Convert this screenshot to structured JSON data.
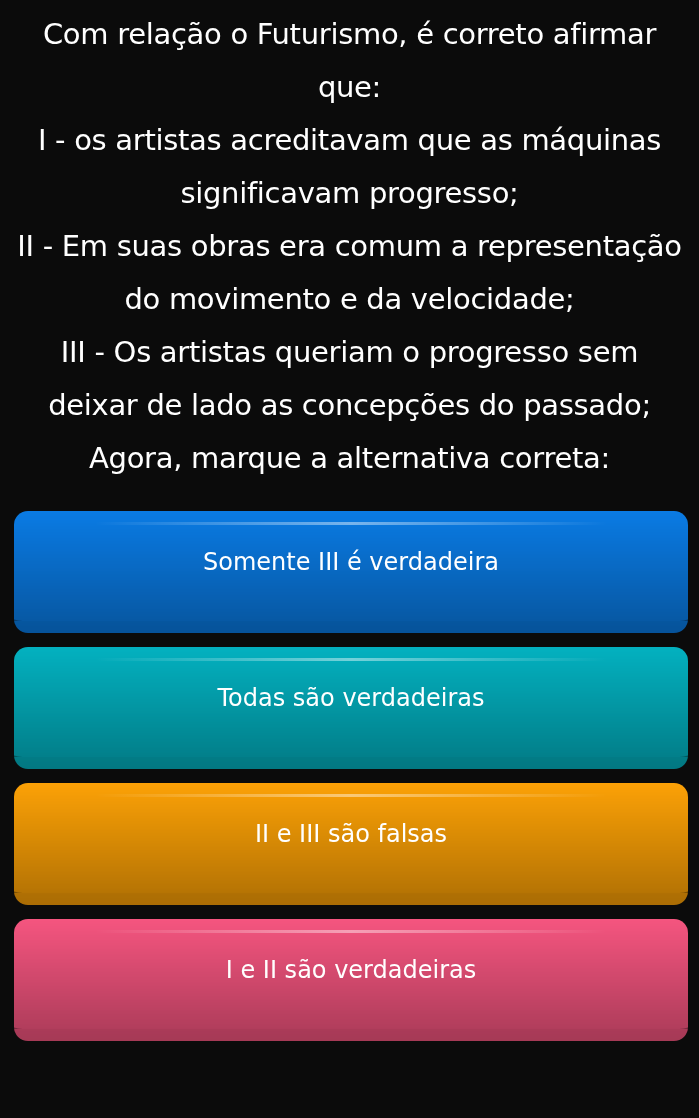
{
  "question": {
    "paragraphs": [
      "Com relação o Futurismo, é correto afirmar que:",
      "I - os artistas acreditavam que as máquinas significavam progresso;",
      "II - Em suas obras era comum a representação do movimento e da velocidade;",
      "III - Os artistas queriam o progresso sem deixar de lado as concepções do passado;",
      "Agora, marque a alternativa correta:"
    ]
  },
  "answers": [
    {
      "label": "Somente III é verdadeira",
      "color": "#0a7be4"
    },
    {
      "label": "Todas são verdadeiras",
      "color": "#03b1c0"
    },
    {
      "label": "II e III são falsas",
      "color": "#fca106"
    },
    {
      "label": "I e II são verdadeiras",
      "color": "#f5557f"
    }
  ]
}
